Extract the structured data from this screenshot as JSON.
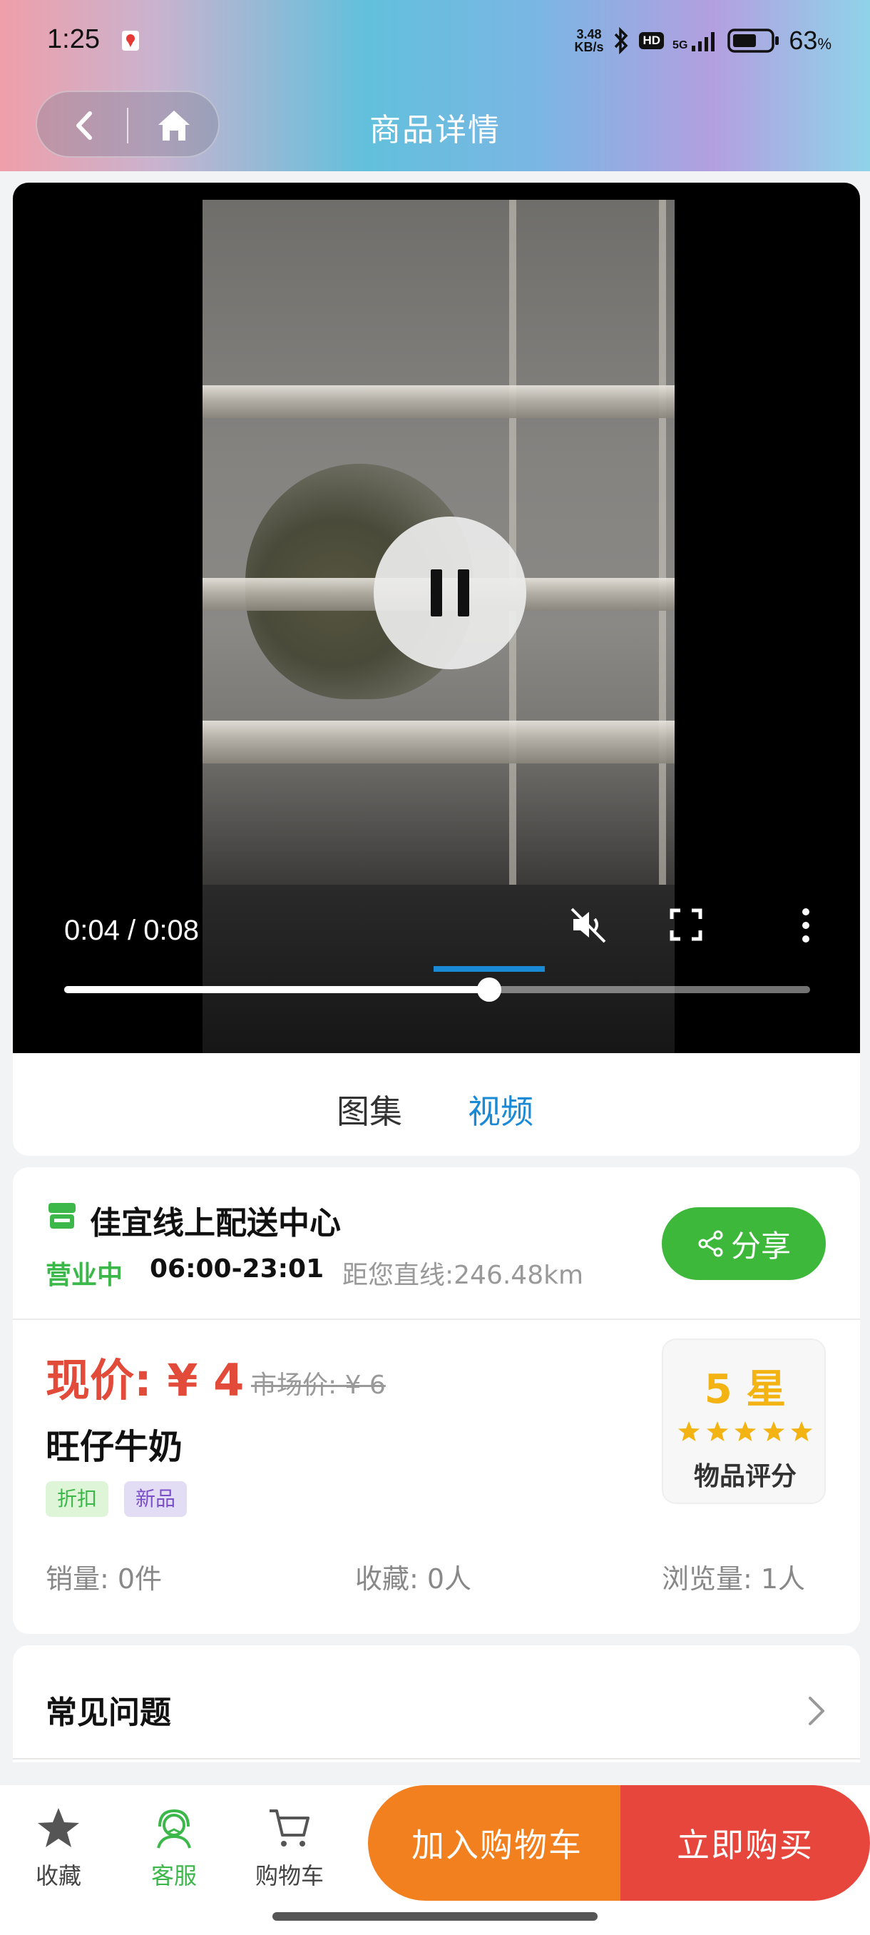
{
  "status_bar": {
    "time": "1:25",
    "net_speed_top": "3.48",
    "net_speed_bottom": "KB/s",
    "hd_label": "HD",
    "network_label": "5G",
    "battery_percent": "63",
    "battery_unit": "%",
    "battery_level": 0.63
  },
  "header": {
    "title": "商品详情",
    "back_icon": "chevron-left-icon",
    "home_icon": "home-icon"
  },
  "video": {
    "time_display": "0:04 / 0:08",
    "progress": 0.57,
    "state": "playing"
  },
  "media_tabs": [
    {
      "label": "图集",
      "active": false
    },
    {
      "label": "视频",
      "active": true
    }
  ],
  "store": {
    "name": "佳宜线上配送中心",
    "status": "营业中",
    "hours": "06:00-23:01",
    "distance": "距您直线:246.48km",
    "share_label": "分享"
  },
  "product": {
    "price_label": "现价: ¥ 4",
    "market_price": "市场价: ¥ 6",
    "name": "旺仔牛奶",
    "tags": [
      "折扣",
      "新品"
    ],
    "rating_value": "5 星",
    "rating_stars": 5,
    "rating_label": "物品评分",
    "sales": "销量: 0件",
    "favorites": "收藏: 0人",
    "views": "浏览量: 1人"
  },
  "faq": {
    "title": "常见问题"
  },
  "bottom_bar": {
    "items": [
      {
        "label": "收藏",
        "icon": "star-icon"
      },
      {
        "label": "客服",
        "icon": "customer-service-icon"
      },
      {
        "label": "购物车",
        "icon": "cart-icon"
      }
    ],
    "add_to_cart": "加入购物车",
    "buy_now": "立即购买"
  },
  "colors": {
    "accent_blue": "#1a8ad6",
    "green": "#3db83b",
    "price_red": "#e24a3a",
    "cart_orange": "#f3801f",
    "buy_red": "#e6463b",
    "star_gold": "#f2b313"
  }
}
